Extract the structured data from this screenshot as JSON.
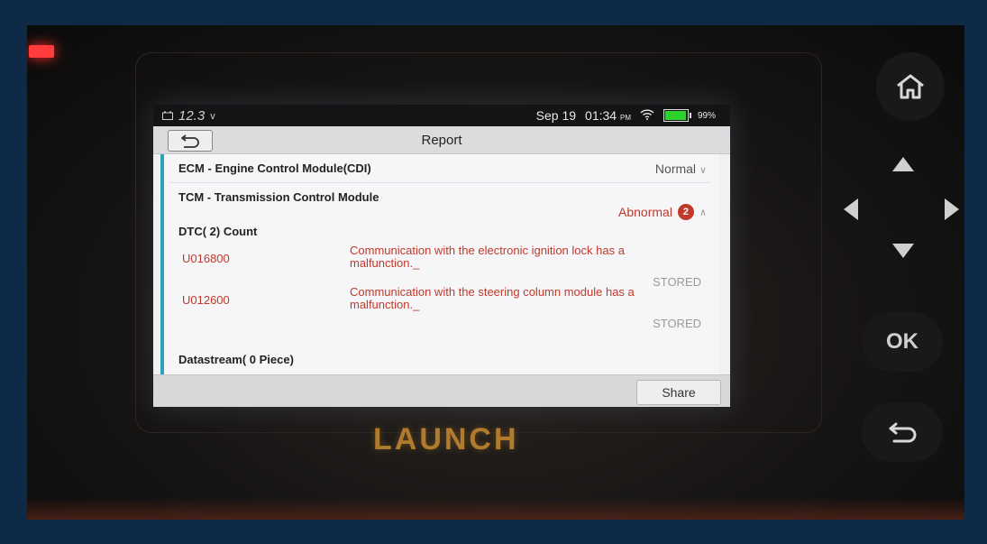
{
  "status_bar": {
    "voltage": "12.3",
    "voltage_unit": "v",
    "date": "Sep 19",
    "time": "01:34",
    "ampm": "PM",
    "battery": "99%"
  },
  "header": {
    "title": "Report"
  },
  "modules": [
    {
      "name": "ECM - Engine Control Module(CDI)",
      "status": "Normal"
    },
    {
      "name": "TCM - Transmission Control Module",
      "status": "Abnormal",
      "count": "2"
    }
  ],
  "dtc": {
    "heading": "DTC( 2) Count",
    "items": [
      {
        "code": "U016800",
        "description": "Communication with the electronic ignition lock has a malfunction._",
        "state": "STORED"
      },
      {
        "code": "U012600",
        "description": "Communication with the steering column module has a malfunction._",
        "state": "STORED"
      }
    ]
  },
  "datastream": {
    "heading": "Datastream( 0 Piece)"
  },
  "footer": {
    "share_label": "Share"
  },
  "device": {
    "brand": "LAUNCH",
    "ok_label": "OK"
  },
  "colors": {
    "accent": "#2aa3b8",
    "error": "#c0392b",
    "battery": "#2ed12e"
  }
}
